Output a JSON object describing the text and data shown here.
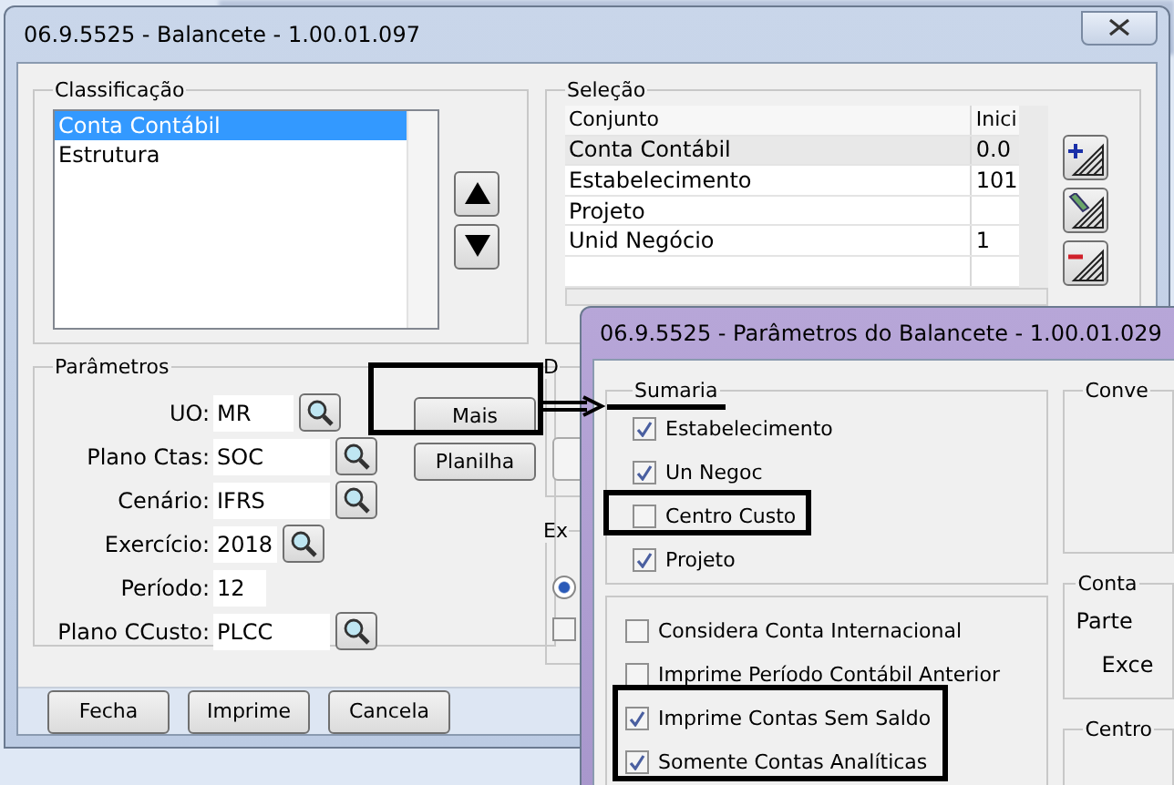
{
  "main_window": {
    "title": "06.9.5525 - Balancete - 1.00.01.097",
    "classificacao": {
      "legend": "Classificação",
      "items": [
        {
          "label": "Conta Contábil",
          "selected": true
        },
        {
          "label": "Estrutura",
          "selected": false
        }
      ]
    },
    "selecao": {
      "legend": "Seleção",
      "columns": [
        "Conjunto",
        "Inici"
      ],
      "rows": [
        {
          "cells": [
            "Conta Contábil",
            "0.0"
          ],
          "selected": true
        },
        {
          "cells": [
            "Estabelecimento",
            "101"
          ],
          "selected": false
        },
        {
          "cells": [
            "Projeto",
            ""
          ],
          "selected": false
        },
        {
          "cells": [
            "Unid Negócio",
            "1"
          ],
          "selected": false
        }
      ]
    },
    "parametros": {
      "legend": "Parâmetros",
      "fields": [
        {
          "label": "UO:",
          "value": "MR",
          "lookup": true
        },
        {
          "label": "Plano Ctas:",
          "value": "SOC",
          "lookup": true
        },
        {
          "label": "Cenário:",
          "value": "IFRS",
          "lookup": true
        },
        {
          "label": "Exercício:",
          "value": "2018",
          "lookup": true
        },
        {
          "label": "Período:",
          "value": "12",
          "lookup": false
        },
        {
          "label": "Plano CCusto:",
          "value": "PLCC",
          "lookup": true
        }
      ],
      "buttons": [
        "Mais",
        "Planilha"
      ]
    },
    "group_2": {
      "legend": "D"
    },
    "group_3": {
      "legend": "Ex",
      "radio": {
        "selected": true
      },
      "checkbox": {
        "checked": false
      }
    },
    "footer_buttons": [
      "Fecha",
      "Imprime",
      "Cancela"
    ]
  },
  "popup": {
    "title": "06.9.5525 - Parâmetros do Balancete - 1.00.01.029",
    "sumaria": {
      "legend": "Sumaria",
      "options": [
        {
          "label": "Estabelecimento",
          "checked": true
        },
        {
          "label": "Un Negoc",
          "checked": true
        },
        {
          "label": "Centro Custo",
          "checked": false
        },
        {
          "label": "Projeto",
          "checked": true
        }
      ]
    },
    "options": [
      {
        "label": "Considera Conta Internacional",
        "checked": false
      },
      {
        "label": "Imprime Período Contábil Anterior",
        "checked": false
      },
      {
        "label": "Imprime Contas Sem Saldo",
        "checked": true
      },
      {
        "label": "Somente Contas Analíticas",
        "checked": true
      }
    ],
    "group_conve": {
      "legend": "Conve"
    },
    "group_conta": {
      "legend": "Conta",
      "labels": [
        "Parte",
        "Exce"
      ]
    },
    "group_centro": {
      "legend": "Centro"
    }
  }
}
